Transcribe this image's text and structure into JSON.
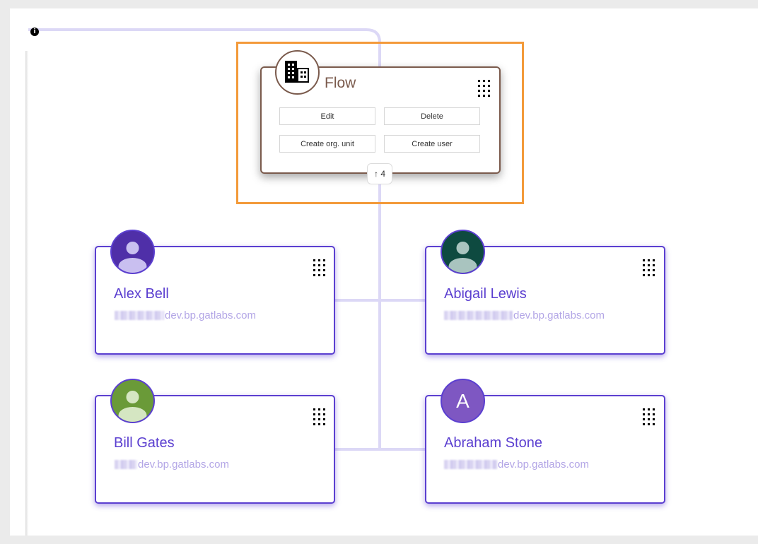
{
  "org_node": {
    "title": "Flow",
    "icon": "building-icon",
    "buttons": {
      "edit": "Edit",
      "delete": "Delete",
      "create_org_unit": "Create org. unit",
      "create_user": "Create user"
    },
    "expand_counter": "↑ 4"
  },
  "users": [
    {
      "name": "Alex Bell",
      "email_domain": "dev.bp.gatlabs.com",
      "avatar_color": "#4f2fa8",
      "avatar_type": "person-icon"
    },
    {
      "name": "Abigail Lewis",
      "email_domain": "dev.bp.gatlabs.com",
      "avatar_color": "#0e4a40",
      "avatar_type": "person-icon"
    },
    {
      "name": "Bill Gates",
      "email_domain": "dev.bp.gatlabs.com",
      "avatar_color": "#6a9a38",
      "avatar_type": "person-icon"
    },
    {
      "name": "Abraham Stone",
      "email_domain": "dev.bp.gatlabs.com",
      "avatar_color": "#7e57c2",
      "avatar_initial": "A"
    }
  ],
  "colors": {
    "accent": "#5b3fd0",
    "org_border": "#7a5a4c",
    "focus_frame": "#f39a3a",
    "connector": "#dcd8f6"
  }
}
